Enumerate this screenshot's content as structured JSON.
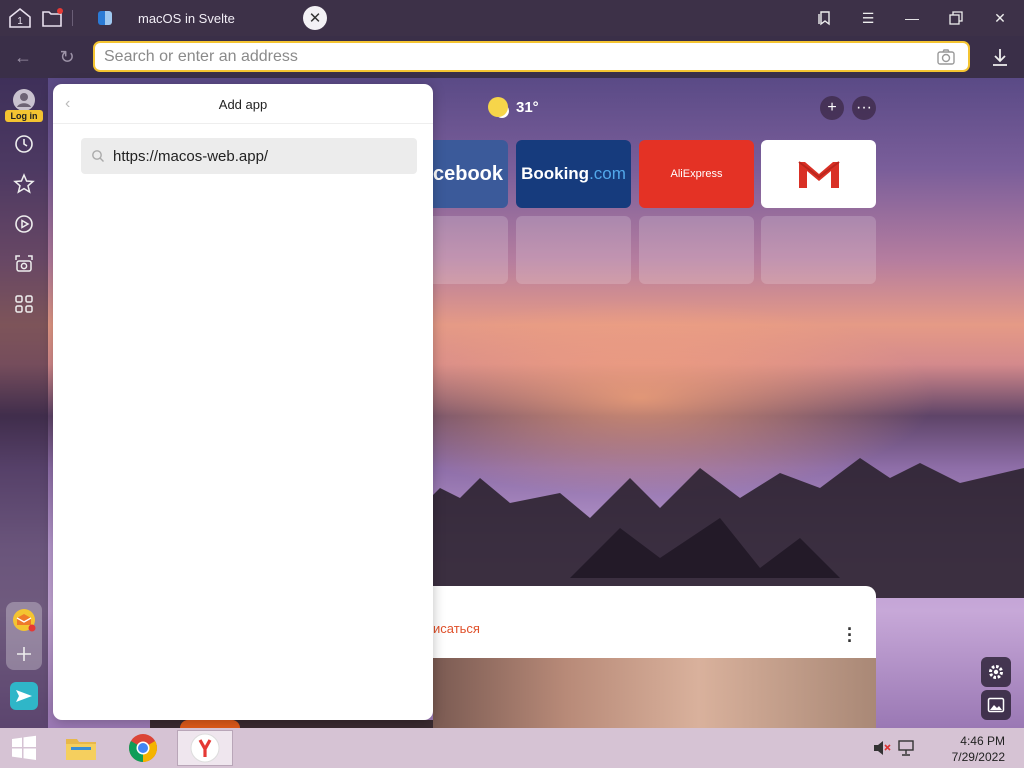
{
  "browser": {
    "tab_counter": "1",
    "tab_title": "macOS in Svelte",
    "address_placeholder": "Search or enter an address"
  },
  "sidebar": {
    "login_label": "Log in",
    "icons": [
      "user-icon",
      "history-icon",
      "bookmarks-star-icon",
      "video-play-icon",
      "screenshot-icon",
      "apps-grid-icon"
    ],
    "bottom_icons": [
      "mail-app-icon",
      "add-app-icon",
      "send-app-icon"
    ]
  },
  "panel": {
    "title": "Add app",
    "search_value": "https://macos-web.app/"
  },
  "newtab": {
    "temperature": "31°",
    "tiles": {
      "facebook": "cebook",
      "booking_main": "Booking",
      "booking_com": ".com",
      "aliexpress": "AliExpress"
    },
    "feed_subscribe": "исаться"
  },
  "taskbar": {
    "time": "4:46 PM",
    "date": "7/29/2022",
    "apps": [
      "windows-start-icon",
      "file-explorer-icon",
      "chrome-icon",
      "yandex-browser-icon"
    ]
  },
  "colors": {
    "accent": "#f4c431",
    "booking_bg": "#163b7d",
    "aliexpress_bg": "#e43225",
    "gmail_red": "#d93025"
  }
}
